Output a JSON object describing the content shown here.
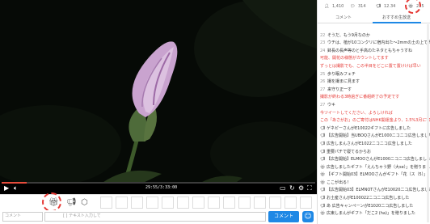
{
  "player": {
    "time_display": "29:55/3:33:00",
    "progress_fraction": 0.08
  },
  "stats": {
    "viewers": "1,410",
    "comments": "314",
    "points": "12.34",
    "gifts": "235"
  },
  "tabs": [
    {
      "label": "コメント"
    },
    {
      "label": "おすすめ生放送"
    }
  ],
  "comments": [
    {
      "num": "",
      "text": "",
      "style": "normal",
      "icon": ""
    },
    {
      "num": "22",
      "text": "そうだ、もう9月なのか",
      "style": "normal",
      "icon": ""
    },
    {
      "num": "23",
      "text": "ウチは、植が10コンクリに宿内出た～2mmの土の上で育て",
      "style": "normal",
      "icon": ""
    },
    {
      "num": "24",
      "text": "鉢長の長声等のと手高のたネタともちゃうすね",
      "style": "normal",
      "icon": ""
    },
    {
      "num": "",
      "text": "可能、開花の様態がカウントしてます",
      "style": "red",
      "icon": ""
    },
    {
      "num": "",
      "text": "ずっとは撮影でも、この半目をどこに置て置けけば早い",
      "style": "red",
      "icon": ""
    },
    {
      "num": "25",
      "text": "歩り眠みフェチ",
      "style": "normal",
      "icon": ""
    },
    {
      "num": "26",
      "text": "撮を撮まに見ます",
      "style": "normal",
      "icon": ""
    },
    {
      "num": "27",
      "text": "来守り正一す",
      "style": "normal",
      "icon": ""
    },
    {
      "num": "",
      "text": "撮影が終わる3時過ぎに番組終了の予定です",
      "style": "red",
      "icon": ""
    },
    {
      "num": "27",
      "text": "ウキ",
      "style": "normal",
      "icon": ""
    },
    {
      "num": "",
      "text": "今ツイートしてください、よろしければ",
      "style": "red",
      "icon": ""
    },
    {
      "num": "",
      "text": "この「あさがお」のご寄付はNHK開運金より、1.5%3月に寄付",
      "style": "red",
      "icon": ""
    },
    {
      "num": "",
      "text": "ゲネピーさんがE10022ギフトに広告しました",
      "style": "normal",
      "icon": "📢"
    },
    {
      "num": "",
      "text": "【広告開始】当UBOQさんがE1000ニコニコ広告しました",
      "style": "normal",
      "icon": "📢"
    },
    {
      "num": "",
      "text": "広告しまんさんがE1022ニコニコ広告しました",
      "style": "normal",
      "icon": "📢"
    },
    {
      "num": "",
      "text": "重要パチで寝てるからお",
      "style": "normal",
      "icon": "📢"
    },
    {
      "num": "",
      "text": "【広告開始】ELMOOさんがE1000ニコニコ広告しました",
      "style": "normal",
      "icon": "📢"
    },
    {
      "num": "",
      "text": "広告しましたギフト「えんちゃう野（大se）」を贈りました",
      "style": "normal",
      "icon": "🎁"
    },
    {
      "num": "",
      "text": "【ギフト開始03】ELMOOさんがギフト「花（ス（5）」",
      "style": "normal",
      "icon": "🎁"
    },
    {
      "num": "",
      "text": "ここが出る！",
      "style": "normal",
      "icon": "🎁"
    },
    {
      "num": "",
      "text": "【広告開始03】ELMNOTさんがE10020二コ広告しました",
      "style": "normal",
      "icon": "📢"
    },
    {
      "num": "",
      "text": "お土産さんがE100022ニコニコ広告しました",
      "style": "normal",
      "icon": "📢"
    },
    {
      "num": "",
      "text": "あ 広告キャンペーンがE1020二コ広告しました",
      "style": "normal",
      "icon": "📢"
    },
    {
      "num": "",
      "text": "広東しまんがギフト「だこ2 (ha)」を贈りました",
      "style": "normal",
      "icon": "🎁"
    }
  ],
  "input": {
    "name_placeholder": "コメント",
    "comment_placeholder": "[ ] テキスト入力して",
    "submit_label": "コメント"
  },
  "colors": {
    "accent": "#1e88e5",
    "highlight": "#e53935"
  }
}
